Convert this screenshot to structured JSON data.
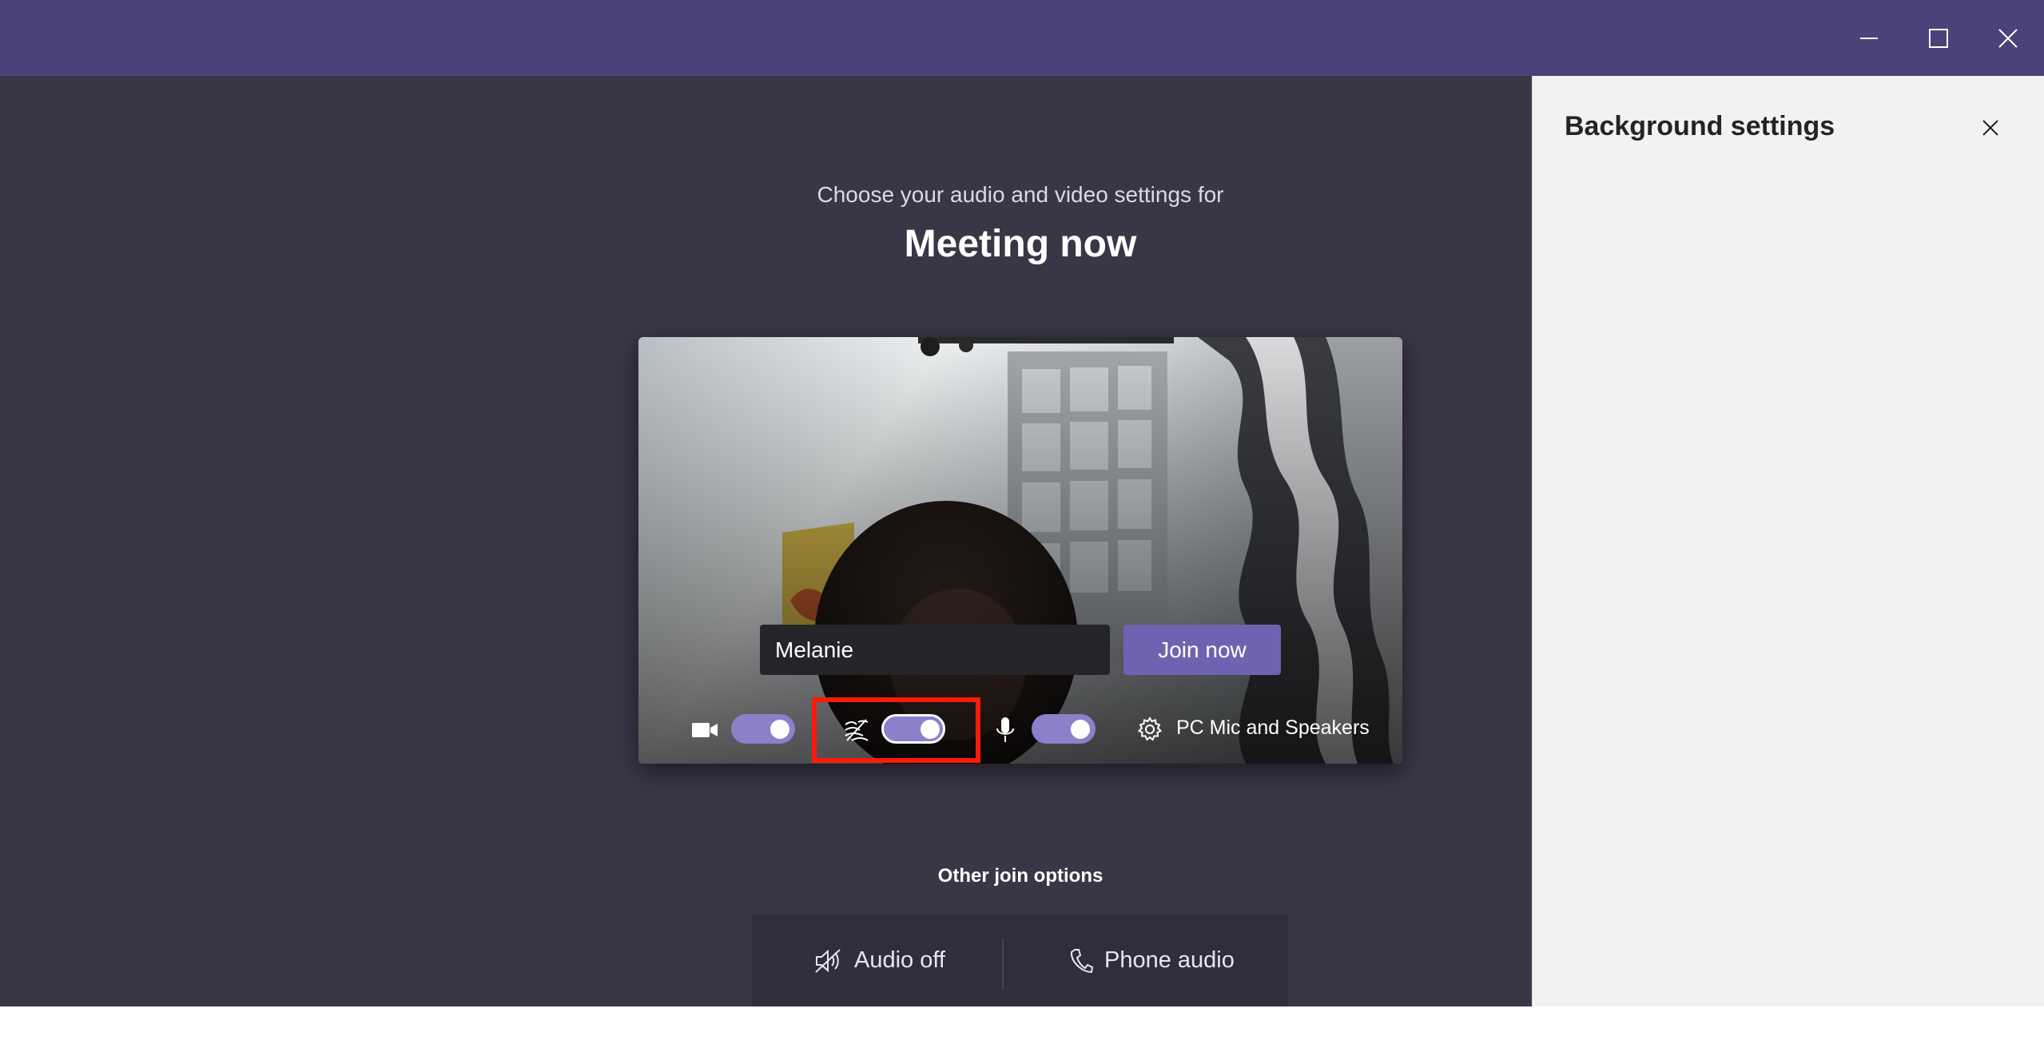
{
  "window": {
    "minimize_icon": "minimize-icon",
    "maximize_icon": "maximize-icon",
    "close_icon": "close-icon",
    "titlebar_color": "#4b4279"
  },
  "prejoin": {
    "subtitle": "Choose your audio and video settings for",
    "meeting_title": "Meeting now",
    "name_value": "Melanie",
    "join_label": "Join now",
    "controls": {
      "camera": {
        "icon": "camera-icon",
        "on": true
      },
      "background_blur": {
        "icon": "background-blur-icon",
        "on": true,
        "highlighted": true
      },
      "microphone": {
        "icon": "microphone-icon",
        "on": true
      },
      "device_settings": {
        "icon": "gear-icon",
        "label": "PC Mic and Speakers"
      }
    },
    "other_join_label": "Other join options",
    "other_options": [
      {
        "icon": "speaker-off-icon",
        "label": "Audio off"
      },
      {
        "icon": "phone-icon",
        "label": "Phone audio"
      }
    ]
  },
  "background_panel": {
    "title": "Background settings",
    "close_icon": "close-icon"
  },
  "colors": {
    "accent": "#6f63b1",
    "toggle_on": "#8b80c9",
    "highlight": "#ff1a0a",
    "stage_bg": "#3a3645",
    "panel_bg": "#f3f2f1"
  }
}
